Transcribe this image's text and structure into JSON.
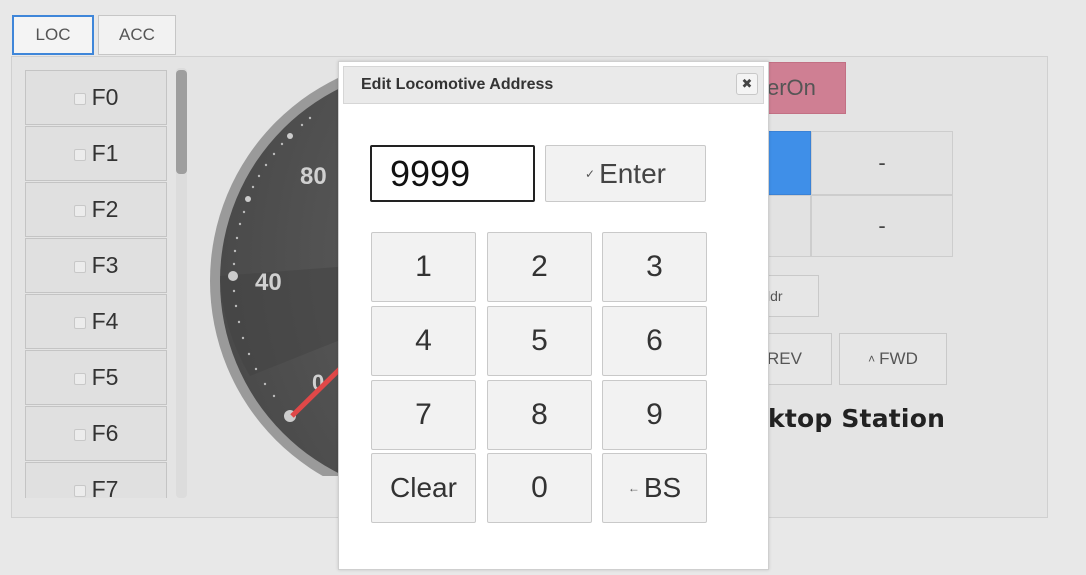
{
  "tabs": [
    {
      "label": "LOC",
      "active": true
    },
    {
      "label": "ACC",
      "active": false
    }
  ],
  "functions": [
    {
      "label": "F0"
    },
    {
      "label": "F1"
    },
    {
      "label": "F2"
    },
    {
      "label": "F3"
    },
    {
      "label": "F4"
    },
    {
      "label": "F5"
    },
    {
      "label": "F6"
    },
    {
      "label": "F7"
    }
  ],
  "gauge": {
    "ticks": [
      "80",
      "40",
      "0"
    ],
    "needle_color": "#e04848"
  },
  "controls": {
    "power_label": "erOn",
    "power_color": "#cf7f93",
    "blue_glyph": ")",
    "dash_1": "-",
    "dash_2": "-",
    "addr_btn_label": "ldr",
    "rev_label": "REV",
    "fwd_label": "FWD",
    "fwd_icon": "up-arrow-icon",
    "station_label": "ktop Station"
  },
  "dialog": {
    "title": "Edit Locomotive Address",
    "close_icon": "close-icon",
    "address_value": "9999",
    "enter_label": "Enter",
    "enter_icon": "check-icon",
    "keys": [
      "1",
      "2",
      "3",
      "4",
      "5",
      "6",
      "7",
      "8",
      "9",
      "Clear",
      "0",
      "BS"
    ],
    "backspace_icon": "left-arrow-icon"
  }
}
